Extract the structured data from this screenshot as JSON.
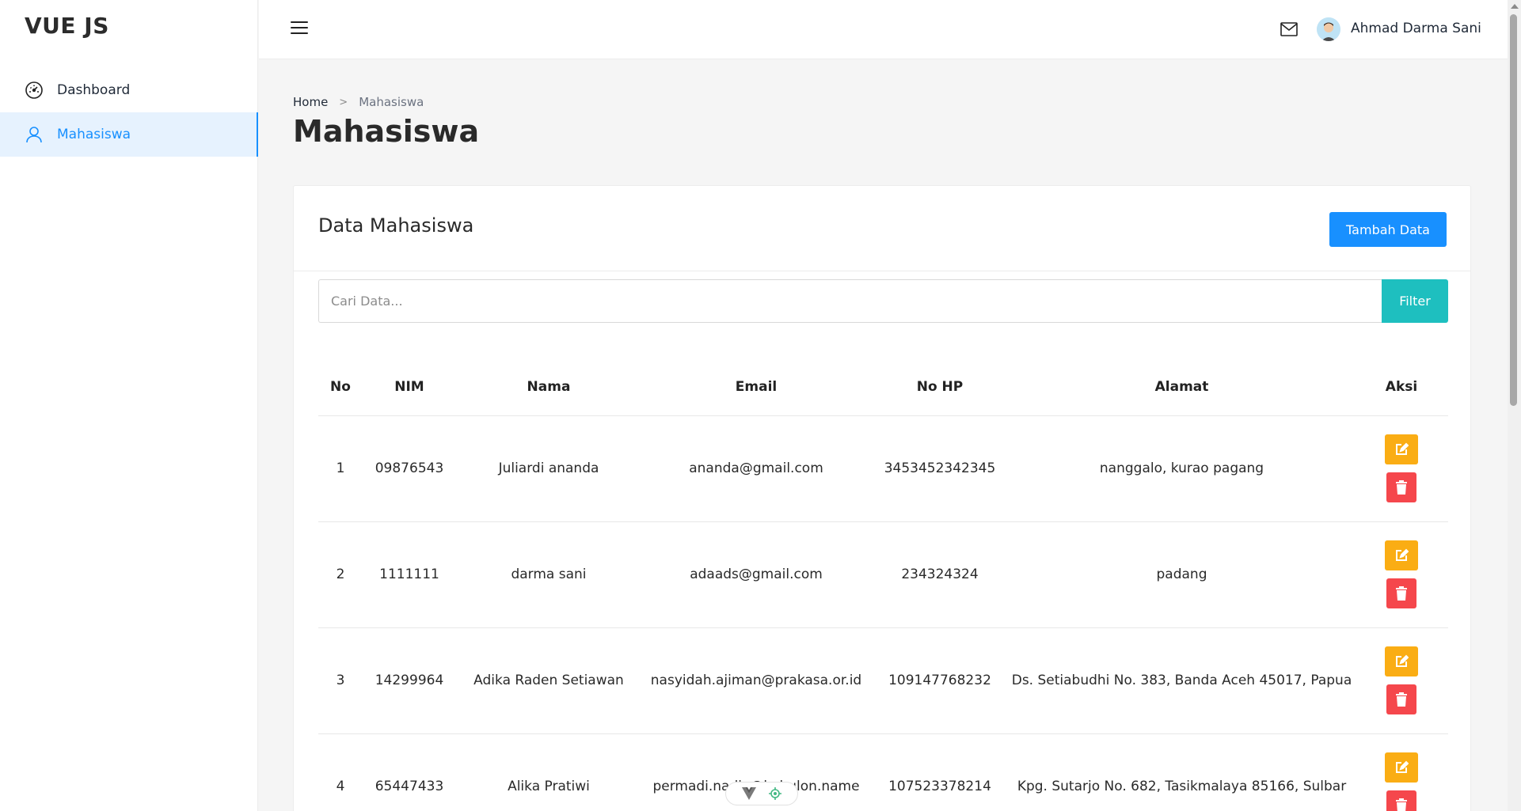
{
  "brand": "VUE JS",
  "sidebar": {
    "items": [
      {
        "label": "Dashboard",
        "icon": "dashboard-icon"
      },
      {
        "label": "Mahasiswa",
        "icon": "user-icon",
        "active": true
      }
    ]
  },
  "header": {
    "menu_icon": "hamburger-icon",
    "mail_icon": "mail-icon",
    "user_name": "Ahmad Darma Sani"
  },
  "breadcrumb": {
    "home": "Home",
    "separator": ">",
    "current": "Mahasiswa"
  },
  "page_title": "Mahasiswa",
  "card": {
    "title": "Data Mahasiswa",
    "add_button": "Tambah Data",
    "search_placeholder": "Cari Data...",
    "filter_button": "Filter"
  },
  "table": {
    "headers": {
      "no": "No",
      "nim": "NIM",
      "nama": "Nama",
      "email": "Email",
      "hp": "No HP",
      "alamat": "Alamat",
      "aksi": "Aksi"
    },
    "rows": [
      {
        "no": "1",
        "nim": "09876543",
        "nama": "Juliardi ananda",
        "email": "ananda@gmail.com",
        "hp": "3453452342345",
        "alamat": "nanggalo, kurao pagang"
      },
      {
        "no": "2",
        "nim": "1111111",
        "nama": "darma sani",
        "email": "adaads@gmail.com",
        "hp": "234324324",
        "alamat": "padang"
      },
      {
        "no": "3",
        "nim": "14299964",
        "nama": "Adika Raden Setiawan",
        "email": "nasyidah.ajiman@prakasa.or.id",
        "hp": "109147768232",
        "alamat": "Ds. Setiabudhi No. 383, Banda Aceh 45017, Papua"
      },
      {
        "no": "4",
        "nim": "65447433",
        "nama": "Alika Pratiwi",
        "email": "permadi.nadia@kuhulon.name",
        "hp": "107523378214",
        "alamat": "Kpg. Sutarjo No. 682, Tasikmalaya 85166, Sulbar"
      }
    ]
  },
  "colors": {
    "primary": "#1890ff",
    "teal": "#1ebfbf",
    "warning": "#faad14",
    "danger": "#f5474c",
    "active_bg": "#e6f2fe"
  }
}
